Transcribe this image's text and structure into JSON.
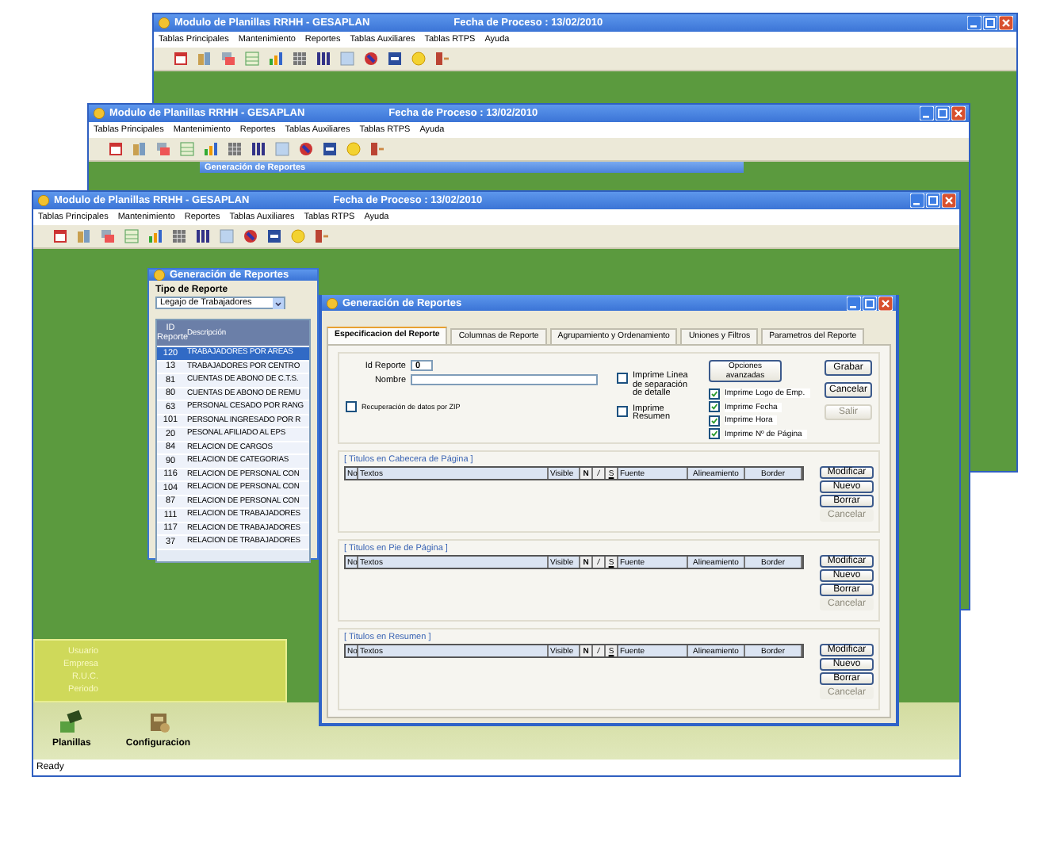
{
  "windows": [
    {
      "title": "Modulo de Planillas  RRHH - GESAPLAN",
      "process_date": "Fecha de Proceso : 13/02/2010",
      "menu": [
        "Tablas Principales",
        "Mantenimiento",
        "Reportes",
        "Tablas Auxiliares",
        "Tablas RTPS",
        "Ayuda"
      ]
    },
    {
      "title": "Modulo de Planillas  RRHH - GESAPLAN",
      "process_date": "Fecha de Proceso : 13/02/2010",
      "menu": [
        "Tablas Principales",
        "Mantenimiento",
        "Reportes",
        "Tablas Auxiliares",
        "Tablas RTPS",
        "Ayuda"
      ],
      "child_title": "Generación de Reportes"
    },
    {
      "title": "Modulo de Planillas  RRHH - GESAPLAN",
      "process_date": "Fecha de Proceso : 13/02/2010",
      "menu": [
        "Tablas Principales",
        "Mantenimiento",
        "Reportes",
        "Tablas Auxiliares",
        "Tablas RTPS",
        "Ayuda"
      ]
    }
  ],
  "list_dialog": {
    "title": "Generación de Reportes",
    "type_label": "Tipo de Reporte",
    "type_value": "Legajo de Trabajadores",
    "columns": [
      "ID Reporte",
      "Descripción"
    ],
    "rows": [
      {
        "id": "120",
        "description": "TRABAJADORES POR AREAS",
        "selected": true
      },
      {
        "id": "13",
        "description": "TRABAJADORES POR CENTRO",
        "selected": false
      },
      {
        "id": "81",
        "description": "CUENTAS DE ABONO DE C.T.S.",
        "selected": false
      },
      {
        "id": "80",
        "description": "CUENTAS DE ABONO DE REMU",
        "selected": false
      },
      {
        "id": "63",
        "description": "PERSONAL CESADO POR RANG",
        "selected": false
      },
      {
        "id": "101",
        "description": "PERSONAL INGRESADO POR R",
        "selected": false
      },
      {
        "id": "20",
        "description": "PESONAL AFILIADO AL EPS",
        "selected": false
      },
      {
        "id": "84",
        "description": "RELACION DE CARGOS",
        "selected": false
      },
      {
        "id": "90",
        "description": "RELACION DE CATEGORIAS",
        "selected": false
      },
      {
        "id": "116",
        "description": "RELACION DE PERSONAL CON",
        "selected": false
      },
      {
        "id": "104",
        "description": "RELACION DE PERSONAL CON",
        "selected": false
      },
      {
        "id": "87",
        "description": "RELACION DE PERSONAL CON",
        "selected": false
      },
      {
        "id": "111",
        "description": "RELACION DE TRABAJADORES",
        "selected": false
      },
      {
        "id": "117",
        "description": "RELACION DE TRABAJADORES",
        "selected": false
      },
      {
        "id": "37",
        "description": "RELACION DE TRABAJADORES",
        "selected": false
      }
    ]
  },
  "report_dialog": {
    "title": "Generación de Reportes",
    "tabs": [
      {
        "label": "Especificacion del Reporte",
        "selected": true
      },
      {
        "label": "Columnas de Reporte",
        "selected": false
      },
      {
        "label": "Agrupamiento y Ordenamiento",
        "selected": false
      },
      {
        "label": "Uniones y Filtros",
        "selected": false
      },
      {
        "label": "Parametros del Reporte",
        "selected": false
      }
    ],
    "id_label": "Id Reporte",
    "id_value": "0",
    "name_label": "Nombre",
    "zip_option": {
      "label": "Recuperación de datos por ZIP",
      "checked": false
    },
    "options": [
      {
        "label": "Imprime Linea de separación de detalle",
        "checked": false
      },
      {
        "label": "Imprime Resumen",
        "checked": false
      }
    ],
    "advanced_label": "Opciones avanzadas",
    "print_options": [
      {
        "label": "Imprime Logo de Emp.",
        "checked": true
      },
      {
        "label": "Imprime Fecha",
        "checked": true
      },
      {
        "label": "Imprime Hora",
        "checked": true
      },
      {
        "label": "Imprime Nº de Página",
        "checked": true
      }
    ],
    "buttons": [
      {
        "label": "Grabar",
        "disabled": false
      },
      {
        "label": "Cancelar",
        "disabled": false
      },
      {
        "label": "Salir",
        "disabled": true
      }
    ],
    "sections": [
      {
        "title": "[ Titulos en Cabecera de Página ]",
        "columns": [
          "No",
          "Textos",
          "Visible",
          "N",
          "/",
          "S",
          "Fuente",
          "Alineamiento",
          "Border"
        ],
        "buttons": [
          {
            "label": "Modificar",
            "disabled": false
          },
          {
            "label": "Nuevo",
            "disabled": false
          },
          {
            "label": "Borrar",
            "disabled": false
          },
          {
            "label": "Cancelar",
            "disabled": true
          }
        ]
      },
      {
        "title": "[ Titulos en Pie de Página ]",
        "columns": [
          "No",
          "Textos",
          "Visible",
          "N",
          "/",
          "S",
          "Fuente",
          "Alineamiento",
          "Border"
        ],
        "buttons": [
          {
            "label": "Modificar",
            "disabled": false
          },
          {
            "label": "Nuevo",
            "disabled": false
          },
          {
            "label": "Borrar",
            "disabled": false
          },
          {
            "label": "Cancelar",
            "disabled": true
          }
        ]
      },
      {
        "title": "[ Titulos en Resumen ]",
        "columns": [
          "No",
          "Textos",
          "Visible",
          "N",
          "/",
          "S",
          "Fuente",
          "Alineamiento",
          "Border"
        ],
        "buttons": [
          {
            "label": "Modificar",
            "disabled": false
          },
          {
            "label": "Nuevo",
            "disabled": false
          },
          {
            "label": "Borrar",
            "disabled": false
          },
          {
            "label": "Cancelar",
            "disabled": true
          }
        ]
      }
    ]
  },
  "user_panel": {
    "labels": [
      "Usuario",
      "Empresa",
      "R.U.C.",
      "Periodo"
    ]
  },
  "shortcuts": [
    {
      "label": "Planillas"
    },
    {
      "label": "Configuracion"
    }
  ],
  "status_bar": "Ready"
}
